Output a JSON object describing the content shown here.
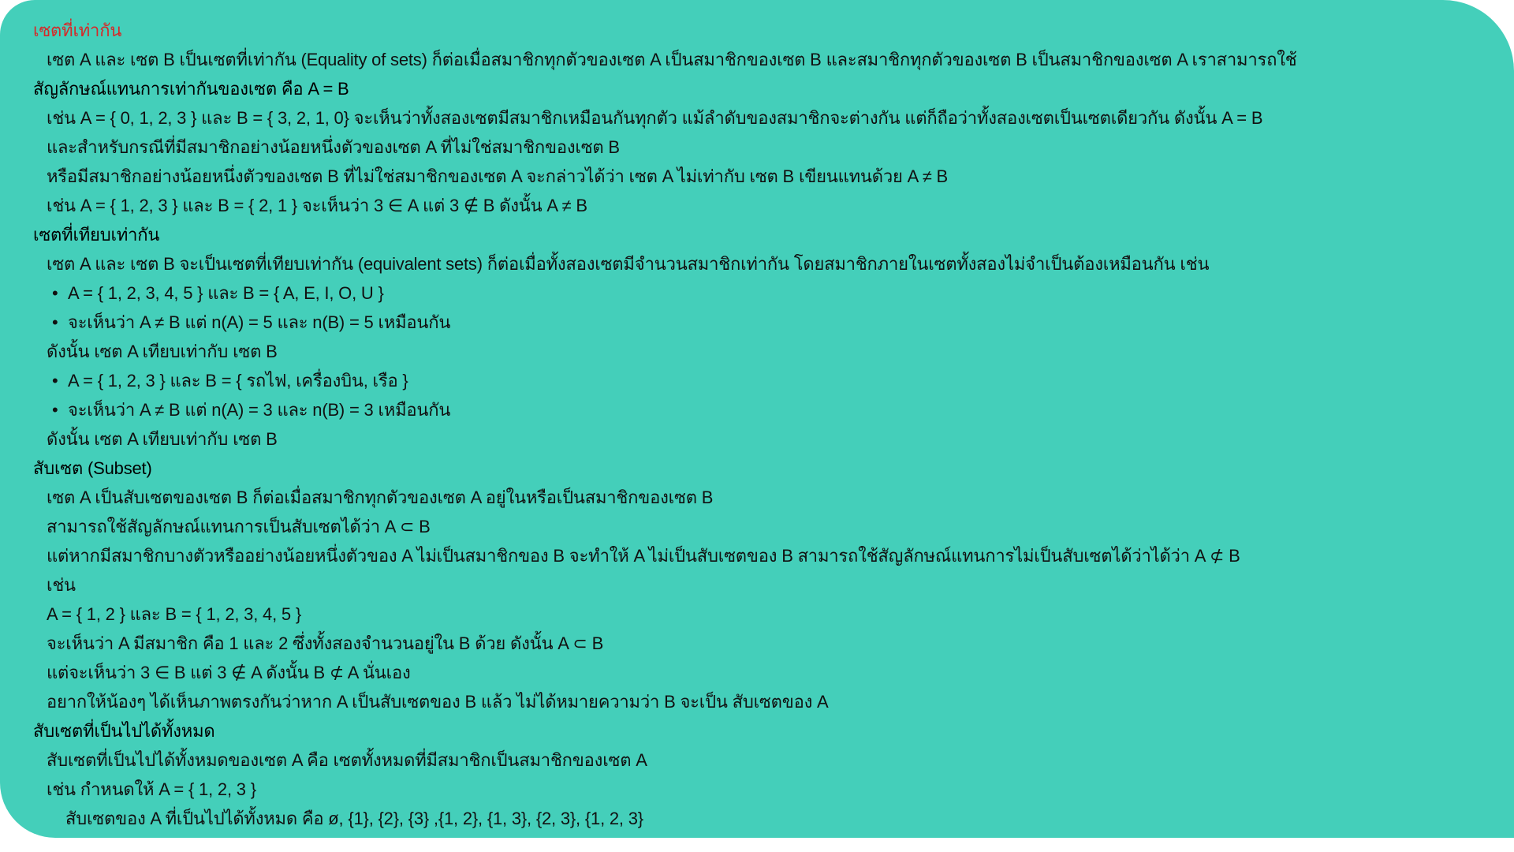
{
  "title": "เซตที่เท่ากัน",
  "colors": {
    "panel": "#44cfba",
    "title": "#d42a2a",
    "text": "#111111"
  },
  "lines": [
    {
      "type": "title",
      "text": "เซตที่เท่ากัน"
    },
    {
      "type": "para",
      "text": "เซต A และ เซต B เป็นเซตที่เท่ากัน (Equality of sets) ก็ต่อเมื่อสมาชิกทุกตัวของเซต A เป็นสมาชิกของเซต B และสมาชิกทุกตัวของเซต B เป็นสมาชิกของเซต A เราสามารถใช้"
    },
    {
      "type": "heading",
      "text": "สัญลักษณ์แทนการเท่ากันของเซต คือ A = B"
    },
    {
      "type": "para",
      "text": "เช่น A = { 0, 1, 2, 3 } และ B = { 3, 2, 1, 0} จะเห็นว่าทั้งสองเซตมีสมาชิกเหมือนกันทุกตัว แม้ลำดับของสมาชิกจะต่างกัน แต่ก็ถือว่าทั้งสองเซตเป็นเซตเดียวกัน ดังนั้น A = B"
    },
    {
      "type": "para",
      "text": "และสำหรับกรณีที่มีสมาชิกอย่างน้อยหนึ่งตัวของเซต A ที่ไม่ใช่สมาชิกของเซต B"
    },
    {
      "type": "para",
      "text": "หรือมีสมาชิกอย่างน้อยหนึ่งตัวของเซต B ที่ไม่ใช่สมาชิกของเซต A จะกล่าวได้ว่า เซต A ไม่เท่ากับ เซต B เขียนแทนด้วย A ≠ B"
    },
    {
      "type": "para",
      "text": "เช่น A = { 1, 2, 3 } และ B = { 2, 1 } จะเห็นว่า 3 ∈ A แต่ 3 ∉ B ดังนั้น A ≠ B"
    },
    {
      "type": "heading",
      "text": "เซตที่เทียบเท่ากัน"
    },
    {
      "type": "para",
      "text": "เซต A และ เซต B จะเป็นเซตที่เทียบเท่ากัน (equivalent sets) ก็ต่อเมื่อทั้งสองเซตมีจำนวนสมาชิกเท่ากัน โดยสมาชิกภายในเซตทั้งสองไม่จำเป็นต้องเหมือนกัน เช่น"
    },
    {
      "type": "bullet",
      "text": "A = { 1, 2, 3, 4, 5 } และ B = { A, E, I, O, U }"
    },
    {
      "type": "bullet",
      "text": "จะเห็นว่า A ≠ B แต่ n(A) = 5 และ n(B) = 5 เหมือนกัน"
    },
    {
      "type": "para",
      "text": "ดังนั้น เซต A เทียบเท่ากับ เซต B"
    },
    {
      "type": "bullet",
      "text": "A = { 1, 2, 3 } และ B = { รถไฟ, เครื่องบิน, เรือ }"
    },
    {
      "type": "bullet",
      "text": "จะเห็นว่า A ≠ B แต่ n(A) = 3 และ n(B) = 3 เหมือนกัน"
    },
    {
      "type": "para",
      "text": "ดังนั้น เซต A เทียบเท่ากับ เซต B"
    },
    {
      "type": "heading",
      "text": "สับเซต (Subset)"
    },
    {
      "type": "para",
      "text": "เซต A เป็นสับเซตของเซต B ก็ต่อเมื่อสมาชิกทุกตัวของเซต A อยู่ในหรือเป็นสมาชิกของเซต B"
    },
    {
      "type": "para",
      "text": "สามารถใช้สัญลักษณ์แทนการเป็นสับเซตได้ว่า A ⊂ B"
    },
    {
      "type": "para",
      "text": "แต่หากมีสมาชิกบางตัวหรืออย่างน้อยหนึ่งตัวของ A ไม่เป็นสมาชิกของ B จะทำให้ A ไม่เป็นสับเซตของ B สามารถใช้สัญลักษณ์แทนการไม่เป็นสับเซตได้ว่าได้ว่า A ⊄ B"
    },
    {
      "type": "para",
      "text": "เช่น"
    },
    {
      "type": "para",
      "text": "A = { 1, 2 } และ B = { 1, 2, 3, 4, 5 }"
    },
    {
      "type": "para",
      "text": "จะเห็นว่า A มีสมาชิก คือ 1 และ 2 ซึ่งทั้งสองจำนวนอยู่ใน B ด้วย ดังนั้น A ⊂ B"
    },
    {
      "type": "para",
      "text": "แต่จะเห็นว่า 3 ∈ B แต่ 3 ∉ A ดังนั้น B ⊄ A นั่นเอง"
    },
    {
      "type": "para",
      "text": "อยากให้น้องๆ ได้เห็นภาพตรงกันว่าหาก A เป็นสับเซตของ B แล้ว ไม่ได้หมายความว่า B จะเป็น สับเซตของ A"
    },
    {
      "type": "heading",
      "text": "สับเซตที่เป็นไปได้ทั้งหมด"
    },
    {
      "type": "para",
      "text": "สับเซตที่เป็นไปได้ทั้งหมดของเซต A คือ เซตทั้งหมดที่มีสมาชิกเป็นสมาชิกของเซต A"
    },
    {
      "type": "para",
      "text": "เช่น กำหนดให้ A = { 1, 2, 3 }"
    },
    {
      "type": "sub",
      "text": "สับเซตของ A ที่เป็นไปได้ทั้งหมด คือ ø, {1}, {2}, {3} ,{1, 2}, {1, 3}, {2, 3}, {1, 2, 3}"
    }
  ]
}
